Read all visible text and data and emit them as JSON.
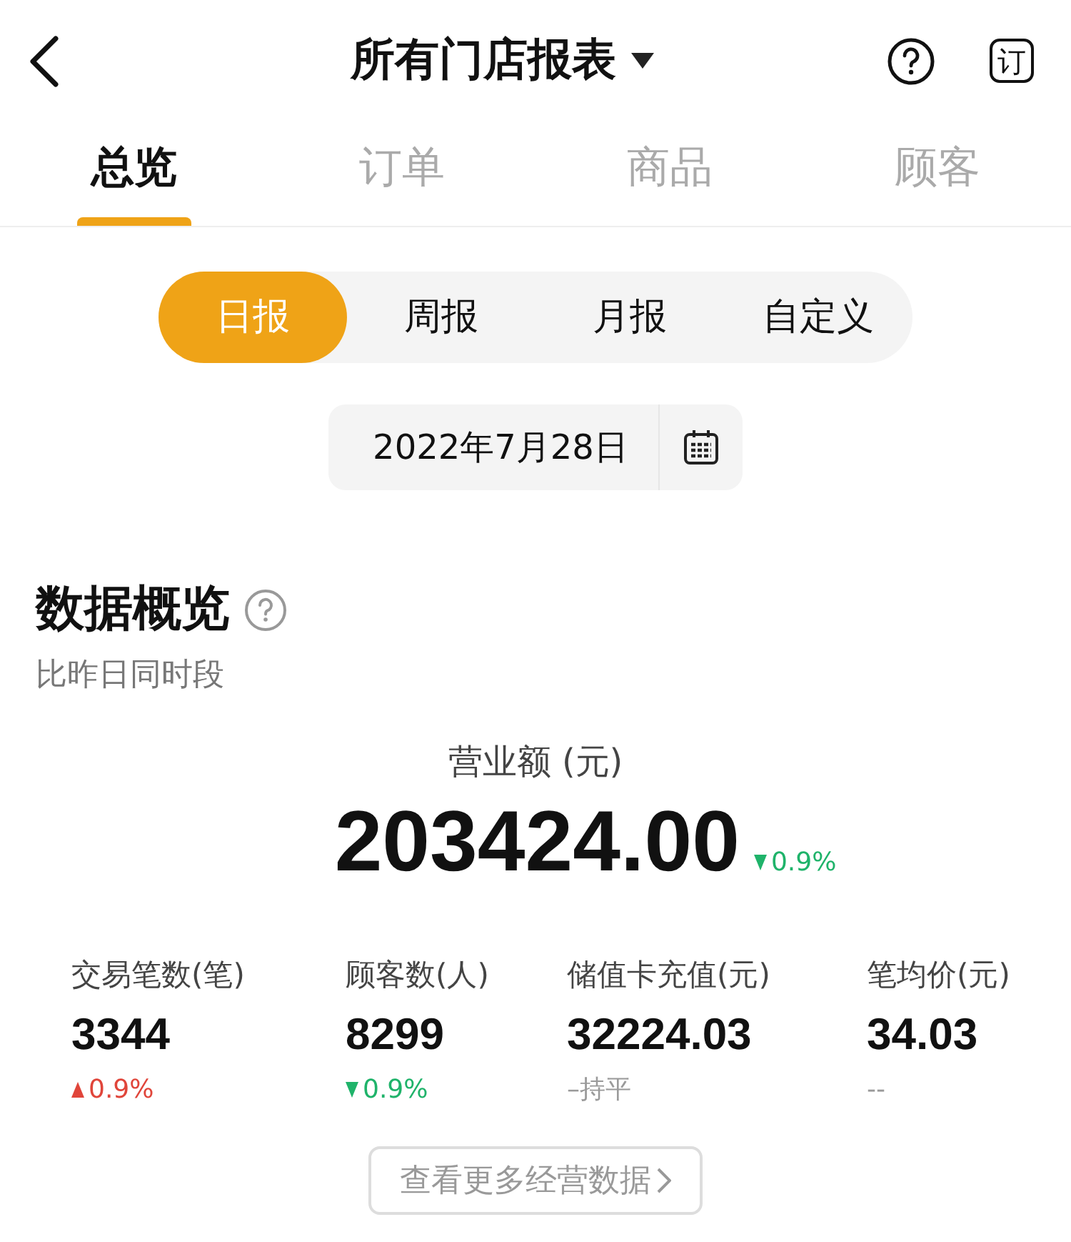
{
  "header": {
    "title": "所有门店报表",
    "subscribe_label": "订"
  },
  "tabs": [
    {
      "label": "总览",
      "selected": true
    },
    {
      "label": "订单",
      "selected": false
    },
    {
      "label": "商品",
      "selected": false
    },
    {
      "label": "顾客",
      "selected": false
    }
  ],
  "periods": [
    {
      "label": "日报",
      "selected": true
    },
    {
      "label": "周报",
      "selected": false
    },
    {
      "label": "月报",
      "selected": false
    },
    {
      "label": "自定义",
      "selected": false
    }
  ],
  "date": "2022年7月28日",
  "overview": {
    "title": "数据概览",
    "subtitle": "比昨日同时段",
    "revenue": {
      "label": "营业额 (元)",
      "value": "203424.00",
      "trend": {
        "kind": "down",
        "text": "0.9%"
      }
    },
    "metrics": [
      {
        "label": "交易笔数(笔)",
        "value": "3344",
        "trend": {
          "kind": "up",
          "text": "0.9%"
        }
      },
      {
        "label": "顾客数(人)",
        "value": "8299",
        "trend": {
          "kind": "down",
          "text": "0.9%"
        }
      },
      {
        "label": "储值卡充值(元)",
        "value": "32224.03",
        "trend": {
          "kind": "flat",
          "text": "–持平"
        }
      },
      {
        "label": "笔均价(元)",
        "value": "34.03",
        "trend": {
          "kind": "none",
          "text": "--"
        }
      }
    ],
    "more_button": "查看更多经营数据"
  }
}
